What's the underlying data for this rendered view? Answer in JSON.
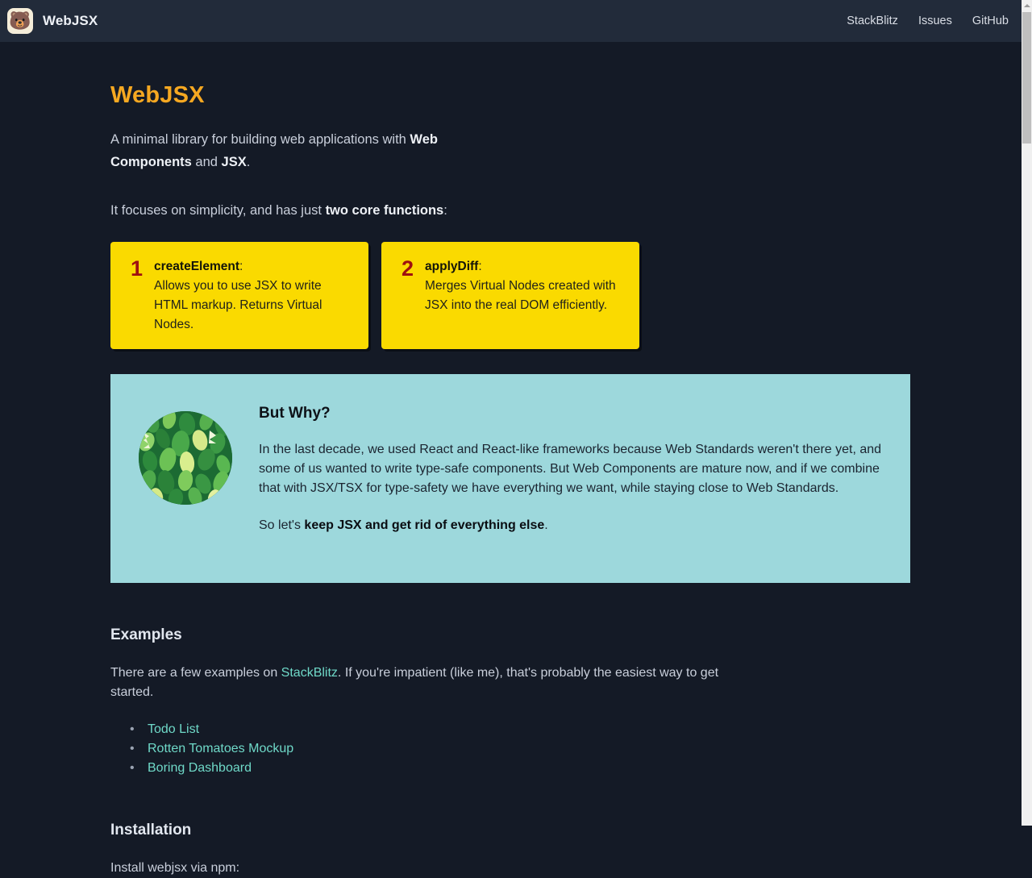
{
  "header": {
    "logo_icon": "bear-face-icon",
    "logo_glyph": "🐻",
    "brand": "WebJSX",
    "nav": [
      {
        "label": "StackBlitz"
      },
      {
        "label": "Issues"
      },
      {
        "label": "GitHub"
      }
    ]
  },
  "main": {
    "title": "WebJSX",
    "lede_1": "A minimal library for building web applications with ",
    "lede_bold_1": "Web Components",
    "lede_mid": " and ",
    "lede_bold_2": "JSX",
    "lede_end": ".",
    "focus_1": "It focuses on simplicity, and has just ",
    "focus_bold": "two core functions",
    "focus_end": ":",
    "cards": [
      {
        "number": "1",
        "name": "createElement",
        "colon": ":",
        "text": "Allows you to use JSX to write HTML markup. Returns Virtual Nodes."
      },
      {
        "number": "2",
        "name": "applyDiff",
        "colon": ":",
        "text": "Merges Virtual Nodes created with JSX into the real DOM efficiently."
      }
    ],
    "why": {
      "image_icon": "green-leaves-circle-image",
      "title": "But Why?",
      "paragraph": "In the last decade, we used React and React-like frameworks because Web Standards weren't there yet, and some of us wanted to write type-safe components. But Web Components are mature now, and if we combine that with JSX/TSX for type-safety we have everything we want, while staying close to Web Standards.",
      "closing_prefix": "So let's ",
      "closing_bold": "keep JSX and get rid of everything else",
      "closing_end": "."
    },
    "examples": {
      "heading": "Examples",
      "intro_1": "There are a few examples on ",
      "intro_link": "StackBlitz",
      "intro_2": ". If you're impatient (like me), that's probably the easiest way to get started.",
      "items": [
        {
          "label": "Todo List"
        },
        {
          "label": "Rotten Tomatoes Mockup"
        },
        {
          "label": "Boring Dashboard"
        }
      ]
    },
    "installation": {
      "heading": "Installation",
      "text": "Install webjsx via npm:"
    }
  },
  "scrollbar": {
    "up_arrow_icon": "chevron-up-icon"
  },
  "colors": {
    "page_bg": "#141a26",
    "header_bg": "#222b3a",
    "accent_orange": "#f6a821",
    "card_yellow": "#fada00",
    "card_number_red": "#9e1010",
    "panel_teal": "#9dd8dc",
    "link_teal": "#6fd9c8",
    "body_text": "#c9cfdb"
  }
}
